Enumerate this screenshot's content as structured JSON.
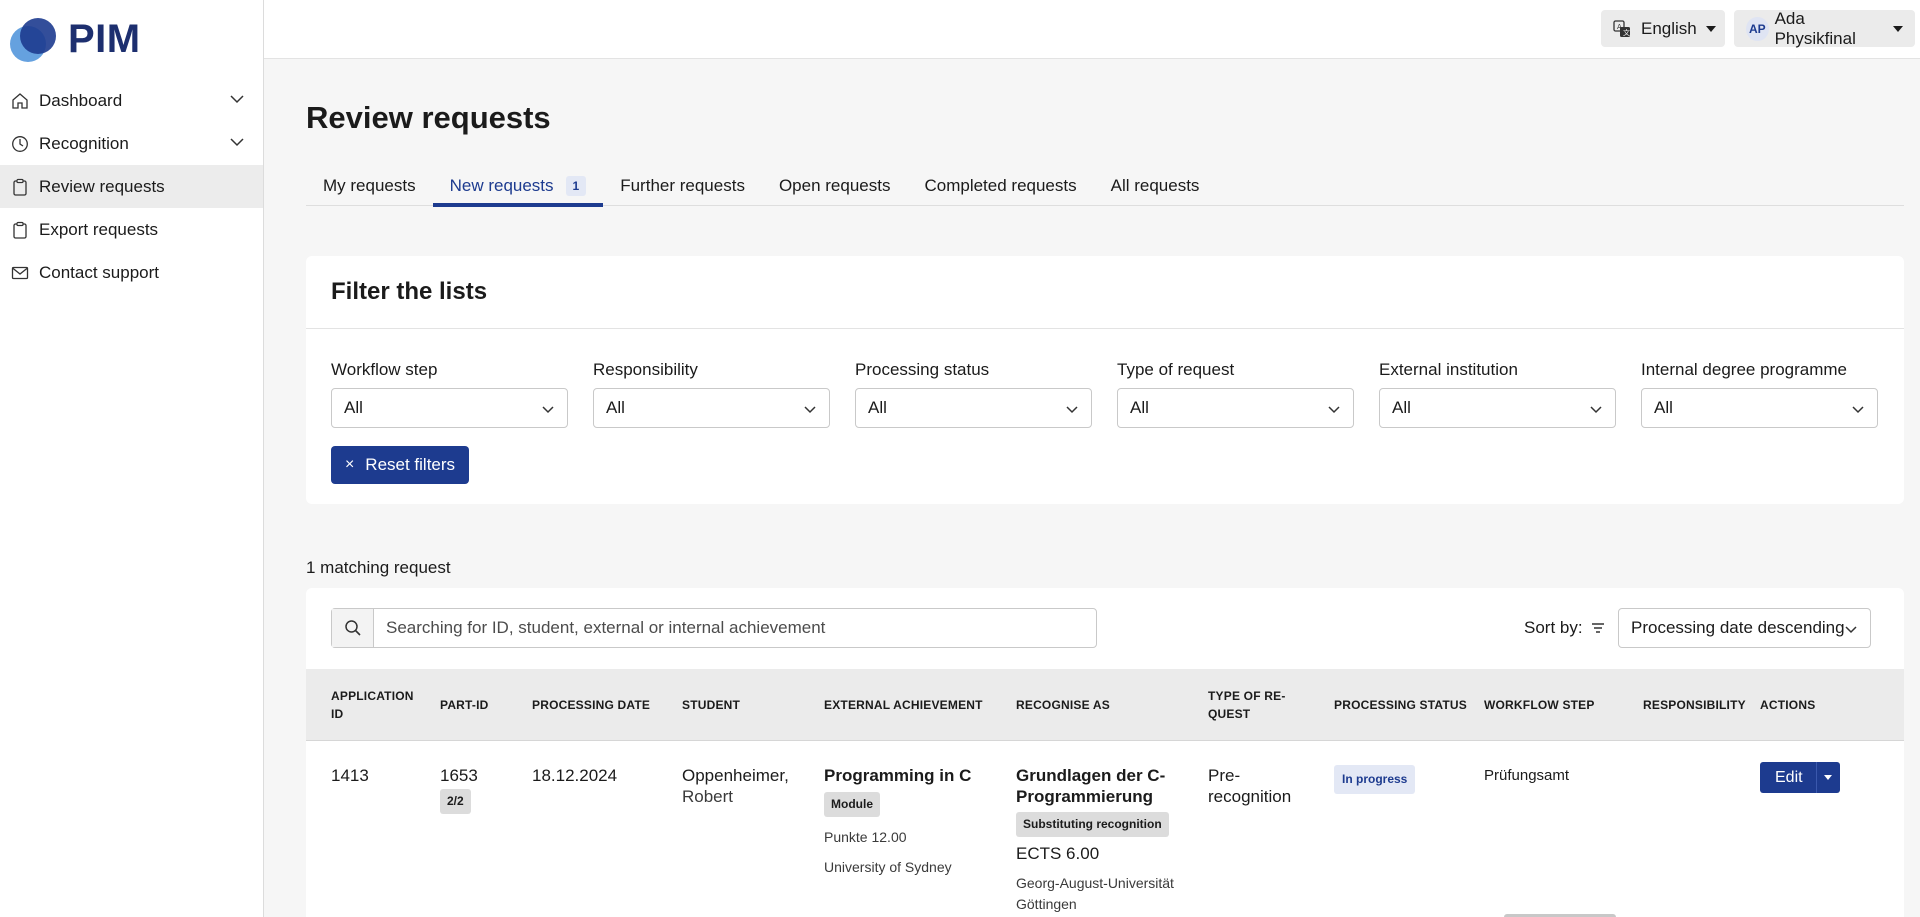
{
  "app": {
    "logo_text": "PIM"
  },
  "sidebar": {
    "items": [
      {
        "label": "Dashboard",
        "icon": "home-icon",
        "expandable": true
      },
      {
        "label": "Recognition",
        "icon": "clock-icon",
        "expandable": true
      },
      {
        "label": "Review requests",
        "icon": "clipboard-icon",
        "active": true
      },
      {
        "label": "Export requests",
        "icon": "clipboard-icon"
      },
      {
        "label": "Contact support",
        "icon": "mail-icon"
      }
    ]
  },
  "topbar": {
    "language": "English",
    "user_initials": "AP",
    "user_name": "Ada Physikfinal"
  },
  "page": {
    "title": "Review requests"
  },
  "tabs": [
    {
      "label": "My requests"
    },
    {
      "label": "New requests",
      "badge": "1",
      "active": true
    },
    {
      "label": "Further requests"
    },
    {
      "label": "Open requests"
    },
    {
      "label": "Completed requests"
    },
    {
      "label": "All requests"
    }
  ],
  "filters": {
    "title": "Filter the lists",
    "groups": [
      {
        "label": "Workflow step",
        "value": "All"
      },
      {
        "label": "Responsibility",
        "value": "All"
      },
      {
        "label": "Processing status",
        "value": "All"
      },
      {
        "label": "Type of request",
        "value": "All"
      },
      {
        "label": "External institution",
        "value": "All"
      },
      {
        "label": "Internal degree programme",
        "value": "All"
      }
    ],
    "reset_label": "Reset filters"
  },
  "results": {
    "count_text": "1 matching request",
    "search_placeholder": "Searching for ID, student, external or internal achievement",
    "sort_label": "Sort by:",
    "sort_value": "Processing date descending",
    "columns": [
      "Application ID",
      "Part-ID",
      "Processing date",
      "Student",
      "External achievement",
      "Recognise as",
      "Type of re-quest",
      "Processing status",
      "Workflow step",
      "Responsibility",
      "Actions"
    ],
    "rows": [
      {
        "application_id": "1413",
        "part_id": "1653",
        "part_count": "2/2",
        "processing_date": "18.12.2024",
        "student_last": "Oppenheimer,",
        "student_first": "Robert",
        "external_title": "Programming in C",
        "external_type": "Module",
        "external_points": "Punkte 12.00",
        "external_institution": "University of Sydney",
        "recognise_title": "Grundlagen der C-Programmierung",
        "recognise_type": "Substituting recognition",
        "recognise_ects": "ECTS 6.00",
        "recognise_institution": "Georg-August-Universität Göttingen",
        "request_type": "Pre-recognition",
        "status": "In progress",
        "workflow_step": "Prüfungsamt",
        "responsibility": "",
        "action_label": "Edit"
      }
    ]
  },
  "colors": {
    "primary": "#1d3b8f",
    "active_bg": "#ececec",
    "header_bg": "#ebebeb"
  }
}
